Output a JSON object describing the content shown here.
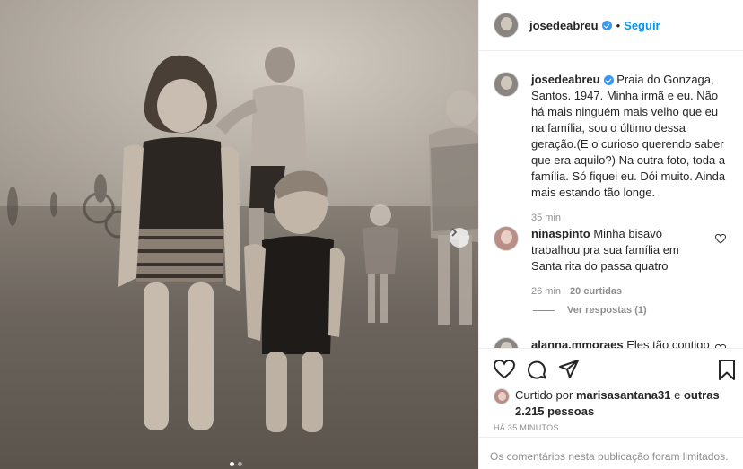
{
  "post": {
    "author": "josedeabreu",
    "follow_label": "Seguir",
    "separator": "•"
  },
  "caption": {
    "author": "josedeabreu",
    "text": "Praia do Gonzaga, Santos. 1947. Minha irmã e eu. Não há mais ninguém mais velho que eu na família, sou o último dessa geração.(E o curioso querendo saber que era aquilo?) Na outra foto, toda a família. Só fiquei eu. Dói muito. Ainda mais estando tão longe.",
    "time": "35 min"
  },
  "comments": [
    {
      "author": "ninaspinto",
      "text": "Minha bisavó trabalhou pra sua família em Santa rita do passa quatro",
      "time": "26 min",
      "likes": "20 curtidas",
      "replies": "Ver respostas (1)"
    },
    {
      "author": "alanna.mmoraes",
      "text": "Eles tão contigo"
    }
  ],
  "likes": {
    "prefix": "Curtido por",
    "user": "marisasantana31",
    "mid": "e",
    "others": "outras 2.215 pessoas"
  },
  "timestamp": "HÁ 35 MINUTOS",
  "limited_notice": "Os comentários nesta publicação foram limitados.",
  "carousel": {
    "count": 2,
    "active": 1
  },
  "icons": {
    "verified": "verified-badge-icon",
    "like": "heart-icon",
    "comment": "comment-icon",
    "share": "share-icon",
    "save": "bookmark-icon",
    "next": "chevron-right-icon"
  },
  "colors": {
    "accent": "#0095f6",
    "muted": "#8e8e8e",
    "verified": "#3897f0"
  }
}
